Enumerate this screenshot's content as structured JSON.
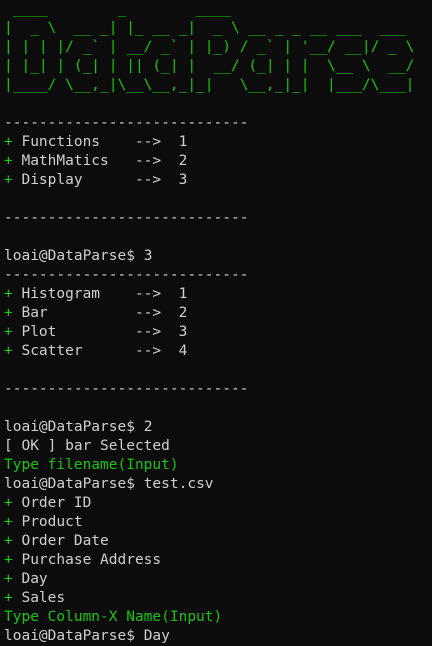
{
  "banner": [
    " ____        _        ____",
    "|  _ \\  __ _| |_ __ _|  _ \\ __ _ _ __ ___  ___",
    "| | | |/ _` | __/ _` | |_) / _` | '__/ __|/ _ \\",
    "| |_| | (_| | || (_| |  __/ (_| | |  \\__ \\  __/",
    "|____/ \\__,_|\\__\\__,_|_|   \\__,_|_|  |___/\\___|"
  ],
  "separator": "----------------------------",
  "prompt": "loai@DataParse$ ",
  "plus": "+ ",
  "main_menu": [
    {
      "label": "Functions    -->  1"
    },
    {
      "label": "MathMatics   -->  2"
    },
    {
      "label": "Display      -->  3"
    }
  ],
  "cmd1": "3",
  "display_menu": [
    {
      "label": "Histogram    -->  1"
    },
    {
      "label": "Bar          -->  2"
    },
    {
      "label": "Plot         -->  3"
    },
    {
      "label": "Scatter      -->  4"
    }
  ],
  "cmd2": "2",
  "status": "[ OK ] bar Selected",
  "type_filename": "Type filename(Input)",
  "cmd3": "test.csv",
  "columns": [
    "Order ID",
    "Product",
    "Order Date",
    "Purchase Address",
    "Day",
    "Sales"
  ],
  "type_column": "Type Column-X Name(Input)",
  "cmd4": "Day"
}
